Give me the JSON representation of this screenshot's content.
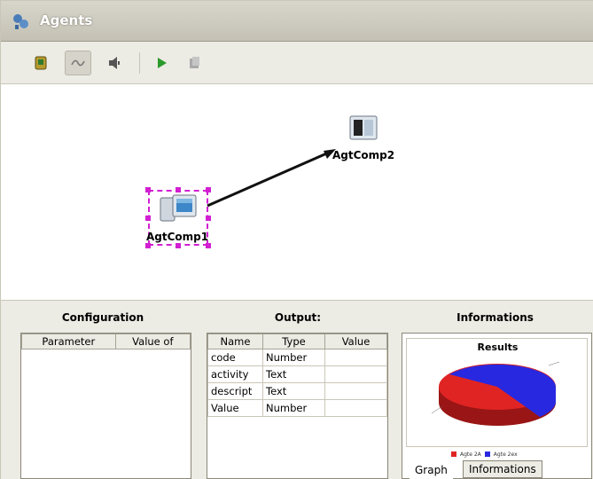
{
  "window": {
    "title": "Agents"
  },
  "toolbar": {
    "buttons": [
      {
        "icon": "agent-add-icon"
      },
      {
        "icon": "connector-icon",
        "active": true
      },
      {
        "icon": "speaker-icon"
      },
      {
        "icon": "play-icon"
      },
      {
        "icon": "stop-icon"
      }
    ]
  },
  "canvas": {
    "nodes": [
      {
        "label": "AgtComp1",
        "selected": true
      },
      {
        "label": "AgtComp2",
        "selected": false
      }
    ],
    "colors": {
      "selection": "#d21fd2",
      "edge": "#111111"
    }
  },
  "configuration": {
    "title": "Configuration",
    "columns": [
      "Parameter",
      "Value of"
    ]
  },
  "output": {
    "title": "Output:",
    "columns": [
      "Name",
      "Type",
      "Value"
    ],
    "rows": [
      {
        "name": "code",
        "type": "Number",
        "value": ""
      },
      {
        "name": "activity",
        "type": "Text",
        "value": ""
      },
      {
        "name": "descript",
        "type": "Text",
        "value": ""
      },
      {
        "name": "Value",
        "type": "Number",
        "value": ""
      }
    ]
  },
  "informations": {
    "title": "Informations",
    "chart_data": {
      "type": "pie",
      "title": "Results",
      "slices": [
        {
          "name": "Agte 2A",
          "value": 0.55,
          "color": "#e02424"
        },
        {
          "name": "Agte 2ex",
          "value": 0.45,
          "color": "#2828e0"
        }
      ]
    },
    "tabs": [
      {
        "label": "Graph",
        "active": true
      },
      {
        "label": "Informations",
        "active": false
      }
    ]
  }
}
